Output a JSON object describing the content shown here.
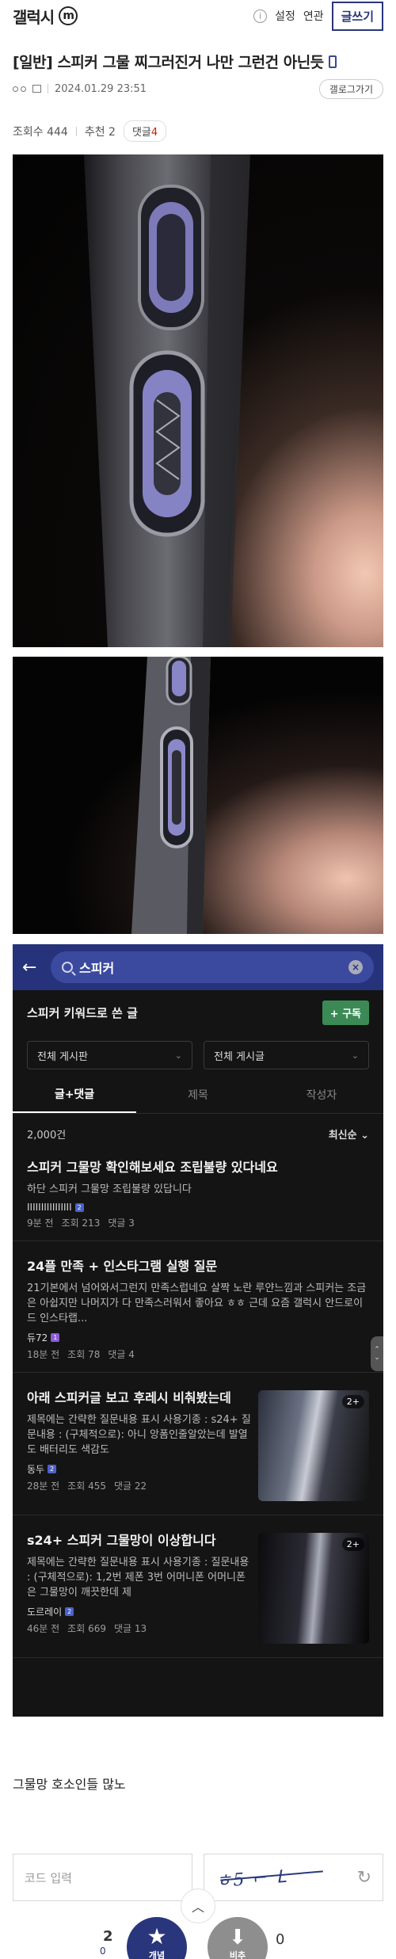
{
  "header": {
    "brand": "갤럭시",
    "brand_badge": "m",
    "info_icon": "ⓘ",
    "settings_label": "설정",
    "related_label": "연관",
    "write_label": "글쓰기"
  },
  "post": {
    "title": "[일반] 스피커 그물 찌그러진거 나만 그런건 아닌듯",
    "date": "2024.01.29 23:51",
    "gallery_button": "갤로그가기",
    "views_label": "조회수 444",
    "recommend_label": "추천 2",
    "replies_label": "댓글",
    "replies_count": "4",
    "body": "그물망 호소인들 많노"
  },
  "screenshot": {
    "search_query": "스피커",
    "keyword_title": "스피커 키워드로 쓴 글",
    "subscribe_label": "+ 구독",
    "board_select": "전체 게시판",
    "post_select": "전체 게시글",
    "tabs": [
      "글+댓글",
      "제목",
      "작성자"
    ],
    "total": "2,000건",
    "sort": "최신순",
    "results": [
      {
        "title": "스피커 그물망 확인해보세요 조립불량 있다네요",
        "snippet": "하단 스피커 그물망 조립불량 있답니다",
        "nick": "IIIIIIIIIIIIIIII",
        "time": "9분 전",
        "views": "조회 213",
        "comments": "댓글 3"
      },
      {
        "title": "24플 만족 + 인스타그램 실행 질문",
        "snippet": "21기본에서 넘어와서그런지 만족스럽네요 살짝 노란 루얀느낌과 스피커는 조금은 아쉽지만 나머지가 다 만족스러워서 좋아요 ㅎㅎ 근데 요즘 갤럭시 안드로이드 인스타랩...",
        "nick": "듀72",
        "time": "18분 전",
        "views": "조회 78",
        "comments": "댓글 4"
      },
      {
        "title": "아래 스피커글 보고 후레시 비춰봤는데",
        "snippet": "제목에는 간략한 질문내용 표시 사용기종 : s24+ 질문내용 : (구체적으로): 아니 앙폼인줄알았는데 발열도 배터리도 색감도",
        "nick": "동두",
        "time": "28분 전",
        "views": "조회 455",
        "comments": "댓글 22",
        "thumb_badge": "2+"
      },
      {
        "title": "s24+ 스피커 그물망이 이상합니다",
        "snippet": "제목에는 간략한 질문내용 표시 사용기종 : 질문내용 : (구체적으로): 1,2번 제폰 3번 어머니폰 어머니폰은 그물망이 깨끗한데 제",
        "nick": "도르레이",
        "time": "46분 전",
        "views": "조회 669",
        "comments": "댓글 13",
        "thumb_badge": "2+"
      }
    ]
  },
  "form": {
    "code_placeholder": "코드 입력",
    "captcha_text": "ㅎ5 ⌐ ᒪ"
  },
  "actions": {
    "recommend_count": "2",
    "recommend_sub": "0",
    "recommend_label": "개념",
    "not_recommend_label": "비추",
    "not_recommend_count": "0"
  }
}
